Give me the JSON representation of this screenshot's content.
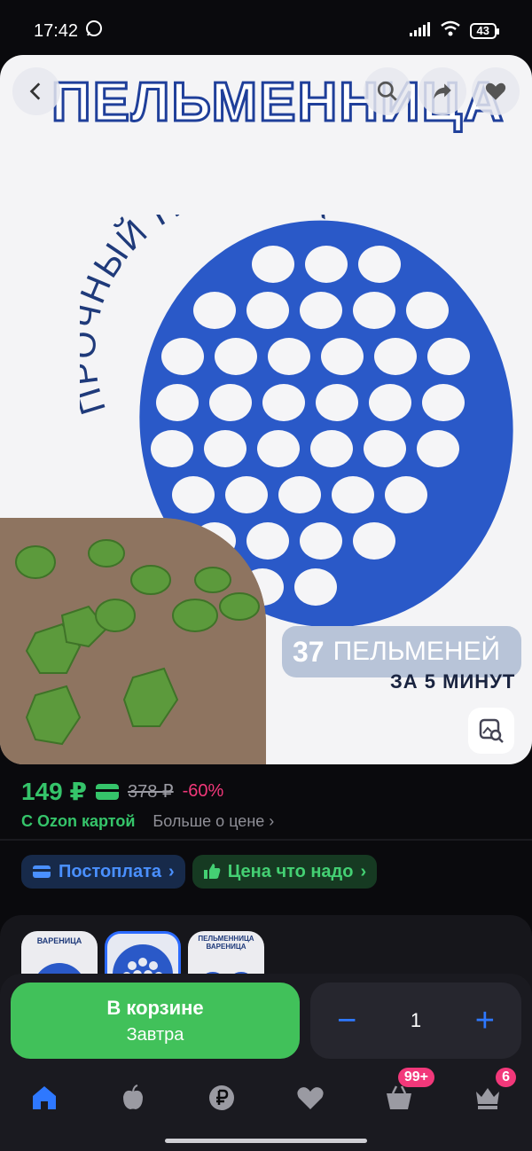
{
  "status": {
    "time": "17:42",
    "battery": "43"
  },
  "hero": {
    "title": "ПЕЛЬМЕННИЦА",
    "arc_text": "ПРОЧНЫЙ ПЛАСТИК",
    "badge_number": "37",
    "badge_text": "ПЕЛЬМЕНЕЙ",
    "sub_prefix": "ЗА",
    "sub_number": "5",
    "sub_suffix": "МИНУТ"
  },
  "price": {
    "current": "149 ₽",
    "old": "378 ₽",
    "discount": "-60%",
    "ozon_card": "С Ozon картой",
    "more": "Больше о цене"
  },
  "chips": [
    {
      "label": "Постоплата"
    },
    {
      "label": "Цена что надо"
    }
  ],
  "thumbs": [
    {
      "caption": "ВАРЕНИЦА"
    },
    {
      "caption": ""
    },
    {
      "caption": "ПЕЛЬМЕННИЦА ВАРЕНИЦА"
    }
  ],
  "cart": {
    "title": "В корзине",
    "subtitle": "Завтра",
    "quantity": "1",
    "minus": "−",
    "plus": "+"
  },
  "tabs": [
    {
      "name": "home",
      "badge": ""
    },
    {
      "name": "fresh",
      "badge": ""
    },
    {
      "name": "finance",
      "badge": ""
    },
    {
      "name": "favorites",
      "badge": ""
    },
    {
      "name": "cart",
      "badge": "99+"
    },
    {
      "name": "profile",
      "badge": "6"
    }
  ],
  "colors": {
    "accent_green": "#41c15a",
    "price_green": "#35c46a",
    "discount_pink": "#f2387a",
    "accent_blue": "#2e78ff"
  }
}
